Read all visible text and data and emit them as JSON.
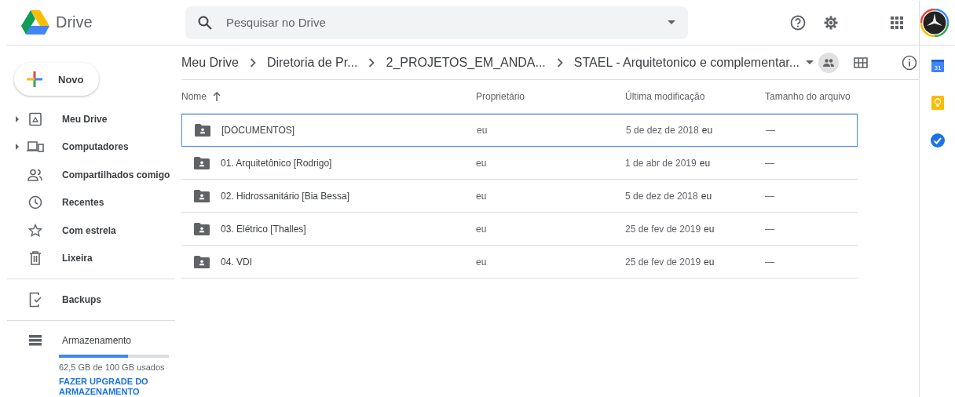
{
  "app": {
    "name": "Drive"
  },
  "search": {
    "placeholder": "Pesquisar no Drive"
  },
  "new_button": {
    "label": "Novo"
  },
  "sidebar": {
    "items": [
      {
        "label": "Meu Drive",
        "expandable": true,
        "selected": false
      },
      {
        "label": "Computadores",
        "expandable": true,
        "selected": false
      },
      {
        "label": "Compartilhados comigo",
        "expandable": false,
        "selected": false
      },
      {
        "label": "Recentes",
        "expandable": false,
        "selected": false
      },
      {
        "label": "Com estrela",
        "expandable": false,
        "selected": false
      },
      {
        "label": "Lixeira",
        "expandable": false,
        "selected": false
      }
    ],
    "backups": {
      "label": "Backups"
    },
    "storage": {
      "label": "Armazenamento",
      "level": 0.625,
      "usage": "62,5 GB de 100 GB usados",
      "upgrade_link": "FAZER UPGRADE DO ARMAZENAMENTO"
    }
  },
  "breadcrumbs": [
    "Meu Drive",
    "Diretoria de Pr...",
    "2_PROJETOS_EM_ANDA...",
    "STAEL - Arquitetonico e complementar..."
  ],
  "table": {
    "columns": [
      "Nome",
      "Proprietário",
      "Última modificação",
      "Tamanho do arquivo"
    ],
    "rows": [
      {
        "name": "[DOCUMENTOS]",
        "owner": "eu",
        "modified": "5 de dez de 2018",
        "modified_by": "eu",
        "size": "—",
        "selected": true
      },
      {
        "name": "01. Arquitetônico [Rodrigo]",
        "owner": "eu",
        "modified": "1 de abr de 2019",
        "modified_by": "eu",
        "size": "—",
        "selected": false
      },
      {
        "name": "02. Hidrossanitário [Bia Bessa]",
        "owner": "eu",
        "modified": "5 de dez de 2018",
        "modified_by": "eu",
        "size": "—",
        "selected": false
      },
      {
        "name": "03. Elétrico [Thalles]",
        "owner": "eu",
        "modified": "25 de fev de 2019",
        "modified_by": "eu",
        "size": "—",
        "selected": false
      },
      {
        "name": "04. VDI",
        "owner": "eu",
        "modified": "25 de fev de 2019",
        "modified_by": "eu",
        "size": "—",
        "selected": false
      }
    ]
  },
  "side_panel": {
    "calendar_day": "31"
  }
}
